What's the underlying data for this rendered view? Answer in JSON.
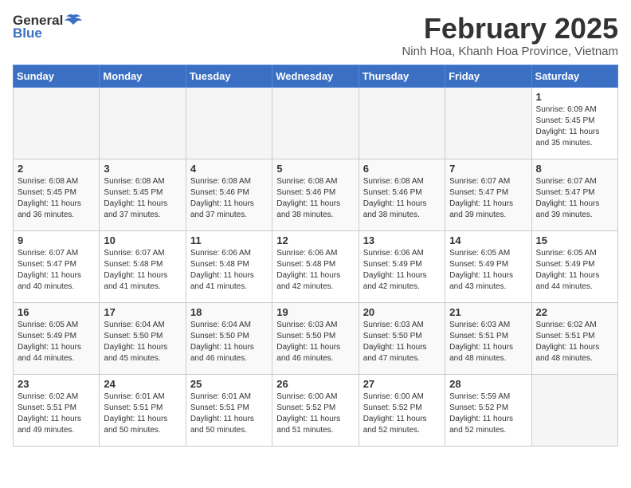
{
  "logo": {
    "general": "General",
    "blue": "Blue"
  },
  "header": {
    "title": "February 2025",
    "subtitle": "Ninh Hoa, Khanh Hoa Province, Vietnam"
  },
  "weekdays": [
    "Sunday",
    "Monday",
    "Tuesday",
    "Wednesday",
    "Thursday",
    "Friday",
    "Saturday"
  ],
  "weeks": [
    [
      {
        "day": "",
        "info": ""
      },
      {
        "day": "",
        "info": ""
      },
      {
        "day": "",
        "info": ""
      },
      {
        "day": "",
        "info": ""
      },
      {
        "day": "",
        "info": ""
      },
      {
        "day": "",
        "info": ""
      },
      {
        "day": "1",
        "info": "Sunrise: 6:09 AM\nSunset: 5:45 PM\nDaylight: 11 hours and 35 minutes."
      }
    ],
    [
      {
        "day": "2",
        "info": "Sunrise: 6:08 AM\nSunset: 5:45 PM\nDaylight: 11 hours and 36 minutes."
      },
      {
        "day": "3",
        "info": "Sunrise: 6:08 AM\nSunset: 5:45 PM\nDaylight: 11 hours and 37 minutes."
      },
      {
        "day": "4",
        "info": "Sunrise: 6:08 AM\nSunset: 5:46 PM\nDaylight: 11 hours and 37 minutes."
      },
      {
        "day": "5",
        "info": "Sunrise: 6:08 AM\nSunset: 5:46 PM\nDaylight: 11 hours and 38 minutes."
      },
      {
        "day": "6",
        "info": "Sunrise: 6:08 AM\nSunset: 5:46 PM\nDaylight: 11 hours and 38 minutes."
      },
      {
        "day": "7",
        "info": "Sunrise: 6:07 AM\nSunset: 5:47 PM\nDaylight: 11 hours and 39 minutes."
      },
      {
        "day": "8",
        "info": "Sunrise: 6:07 AM\nSunset: 5:47 PM\nDaylight: 11 hours and 39 minutes."
      }
    ],
    [
      {
        "day": "9",
        "info": "Sunrise: 6:07 AM\nSunset: 5:47 PM\nDaylight: 11 hours and 40 minutes."
      },
      {
        "day": "10",
        "info": "Sunrise: 6:07 AM\nSunset: 5:48 PM\nDaylight: 11 hours and 41 minutes."
      },
      {
        "day": "11",
        "info": "Sunrise: 6:06 AM\nSunset: 5:48 PM\nDaylight: 11 hours and 41 minutes."
      },
      {
        "day": "12",
        "info": "Sunrise: 6:06 AM\nSunset: 5:48 PM\nDaylight: 11 hours and 42 minutes."
      },
      {
        "day": "13",
        "info": "Sunrise: 6:06 AM\nSunset: 5:49 PM\nDaylight: 11 hours and 42 minutes."
      },
      {
        "day": "14",
        "info": "Sunrise: 6:05 AM\nSunset: 5:49 PM\nDaylight: 11 hours and 43 minutes."
      },
      {
        "day": "15",
        "info": "Sunrise: 6:05 AM\nSunset: 5:49 PM\nDaylight: 11 hours and 44 minutes."
      }
    ],
    [
      {
        "day": "16",
        "info": "Sunrise: 6:05 AM\nSunset: 5:49 PM\nDaylight: 11 hours and 44 minutes."
      },
      {
        "day": "17",
        "info": "Sunrise: 6:04 AM\nSunset: 5:50 PM\nDaylight: 11 hours and 45 minutes."
      },
      {
        "day": "18",
        "info": "Sunrise: 6:04 AM\nSunset: 5:50 PM\nDaylight: 11 hours and 46 minutes."
      },
      {
        "day": "19",
        "info": "Sunrise: 6:03 AM\nSunset: 5:50 PM\nDaylight: 11 hours and 46 minutes."
      },
      {
        "day": "20",
        "info": "Sunrise: 6:03 AM\nSunset: 5:50 PM\nDaylight: 11 hours and 47 minutes."
      },
      {
        "day": "21",
        "info": "Sunrise: 6:03 AM\nSunset: 5:51 PM\nDaylight: 11 hours and 48 minutes."
      },
      {
        "day": "22",
        "info": "Sunrise: 6:02 AM\nSunset: 5:51 PM\nDaylight: 11 hours and 48 minutes."
      }
    ],
    [
      {
        "day": "23",
        "info": "Sunrise: 6:02 AM\nSunset: 5:51 PM\nDaylight: 11 hours and 49 minutes."
      },
      {
        "day": "24",
        "info": "Sunrise: 6:01 AM\nSunset: 5:51 PM\nDaylight: 11 hours and 50 minutes."
      },
      {
        "day": "25",
        "info": "Sunrise: 6:01 AM\nSunset: 5:51 PM\nDaylight: 11 hours and 50 minutes."
      },
      {
        "day": "26",
        "info": "Sunrise: 6:00 AM\nSunset: 5:52 PM\nDaylight: 11 hours and 51 minutes."
      },
      {
        "day": "27",
        "info": "Sunrise: 6:00 AM\nSunset: 5:52 PM\nDaylight: 11 hours and 52 minutes."
      },
      {
        "day": "28",
        "info": "Sunrise: 5:59 AM\nSunset: 5:52 PM\nDaylight: 11 hours and 52 minutes."
      },
      {
        "day": "",
        "info": ""
      }
    ]
  ]
}
